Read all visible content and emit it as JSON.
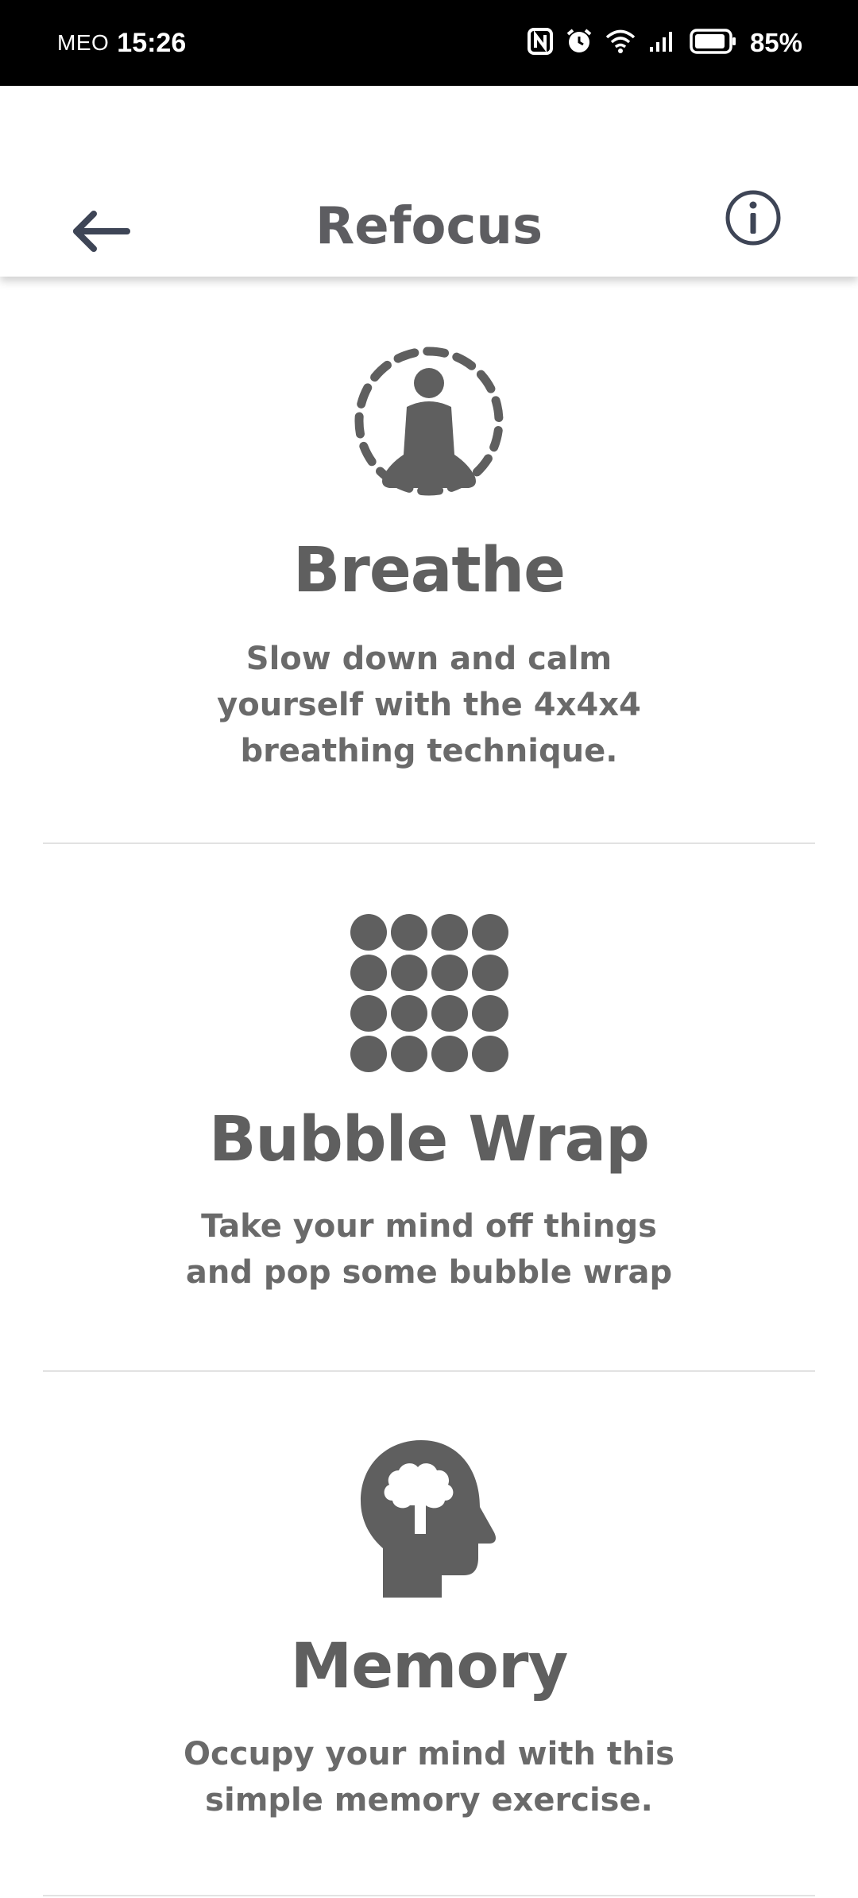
{
  "status_bar": {
    "carrier": "MEO",
    "time": "15:26",
    "battery": "85%",
    "icons": [
      "nfc-icon",
      "alarm-icon",
      "wifi-icon",
      "signal-icon",
      "battery-icon"
    ]
  },
  "header": {
    "title": "Refocus",
    "back_icon": "arrow-left-icon",
    "info_icon": "info-circle-icon"
  },
  "exercises": [
    {
      "icon": "meditation-icon",
      "title": "Breathe",
      "description": "Slow down and calm yourself with the 4x4x4 breathing technique."
    },
    {
      "icon": "bubble-wrap-icon",
      "title": "Bubble Wrap",
      "description": "Take your mind off things and pop some bubble wrap"
    },
    {
      "icon": "brain-head-icon",
      "title": "Memory",
      "description": "Occupy your mind with this simple memory exercise."
    }
  ],
  "colors": {
    "status_bar_bg": "#000000",
    "icon_gray": "#5f5f5f",
    "header_icon": "#3e4556",
    "divider": "#e2e2e2"
  }
}
